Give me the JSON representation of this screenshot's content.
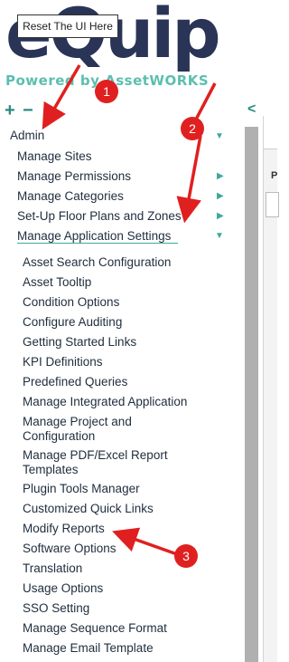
{
  "tooltip": {
    "text": "Reset The UI Here"
  },
  "logo": {
    "brand": "eQuip",
    "tagline": "Powered by AssetWORKS"
  },
  "controls": {
    "expand": "+",
    "collapse_all": "−",
    "collapse_panel": "<"
  },
  "menu": {
    "root": "Admin",
    "level1": [
      {
        "label": "Manage Sites"
      },
      {
        "label": "Manage Permissions"
      },
      {
        "label": "Manage Categories"
      },
      {
        "label": "Set-Up Floor Plans and Zones"
      },
      {
        "label": "Manage Application Settings"
      }
    ],
    "level2": [
      {
        "label": "Asset Search Configuration"
      },
      {
        "label": "Asset Tooltip"
      },
      {
        "label": "Condition Options"
      },
      {
        "label": "Configure Auditing"
      },
      {
        "label": "Getting Started Links"
      },
      {
        "label": "KPI Definitions"
      },
      {
        "label": "Predefined Queries"
      },
      {
        "label": "Manage Integrated Application"
      },
      {
        "label": "Manage Project and Configuration"
      },
      {
        "label": "Manage PDF/Excel Report Templates"
      },
      {
        "label": "Plugin Tools Manager"
      },
      {
        "label": "Customized Quick Links"
      },
      {
        "label": "Modify Reports"
      },
      {
        "label": "Software Options"
      },
      {
        "label": "Translation"
      },
      {
        "label": "Usage Options"
      },
      {
        "label": "SSO Setting"
      },
      {
        "label": "Manage Sequence Format"
      },
      {
        "label": "Manage Email Template"
      }
    ]
  },
  "annotations": {
    "markers": [
      "1",
      "2",
      "3"
    ],
    "color": "#e02020"
  },
  "right_panel": {
    "label": "P"
  },
  "colors": {
    "brand": "#2a3456",
    "accent": "#3fa8a0",
    "tagline": "#5bbfb0"
  }
}
